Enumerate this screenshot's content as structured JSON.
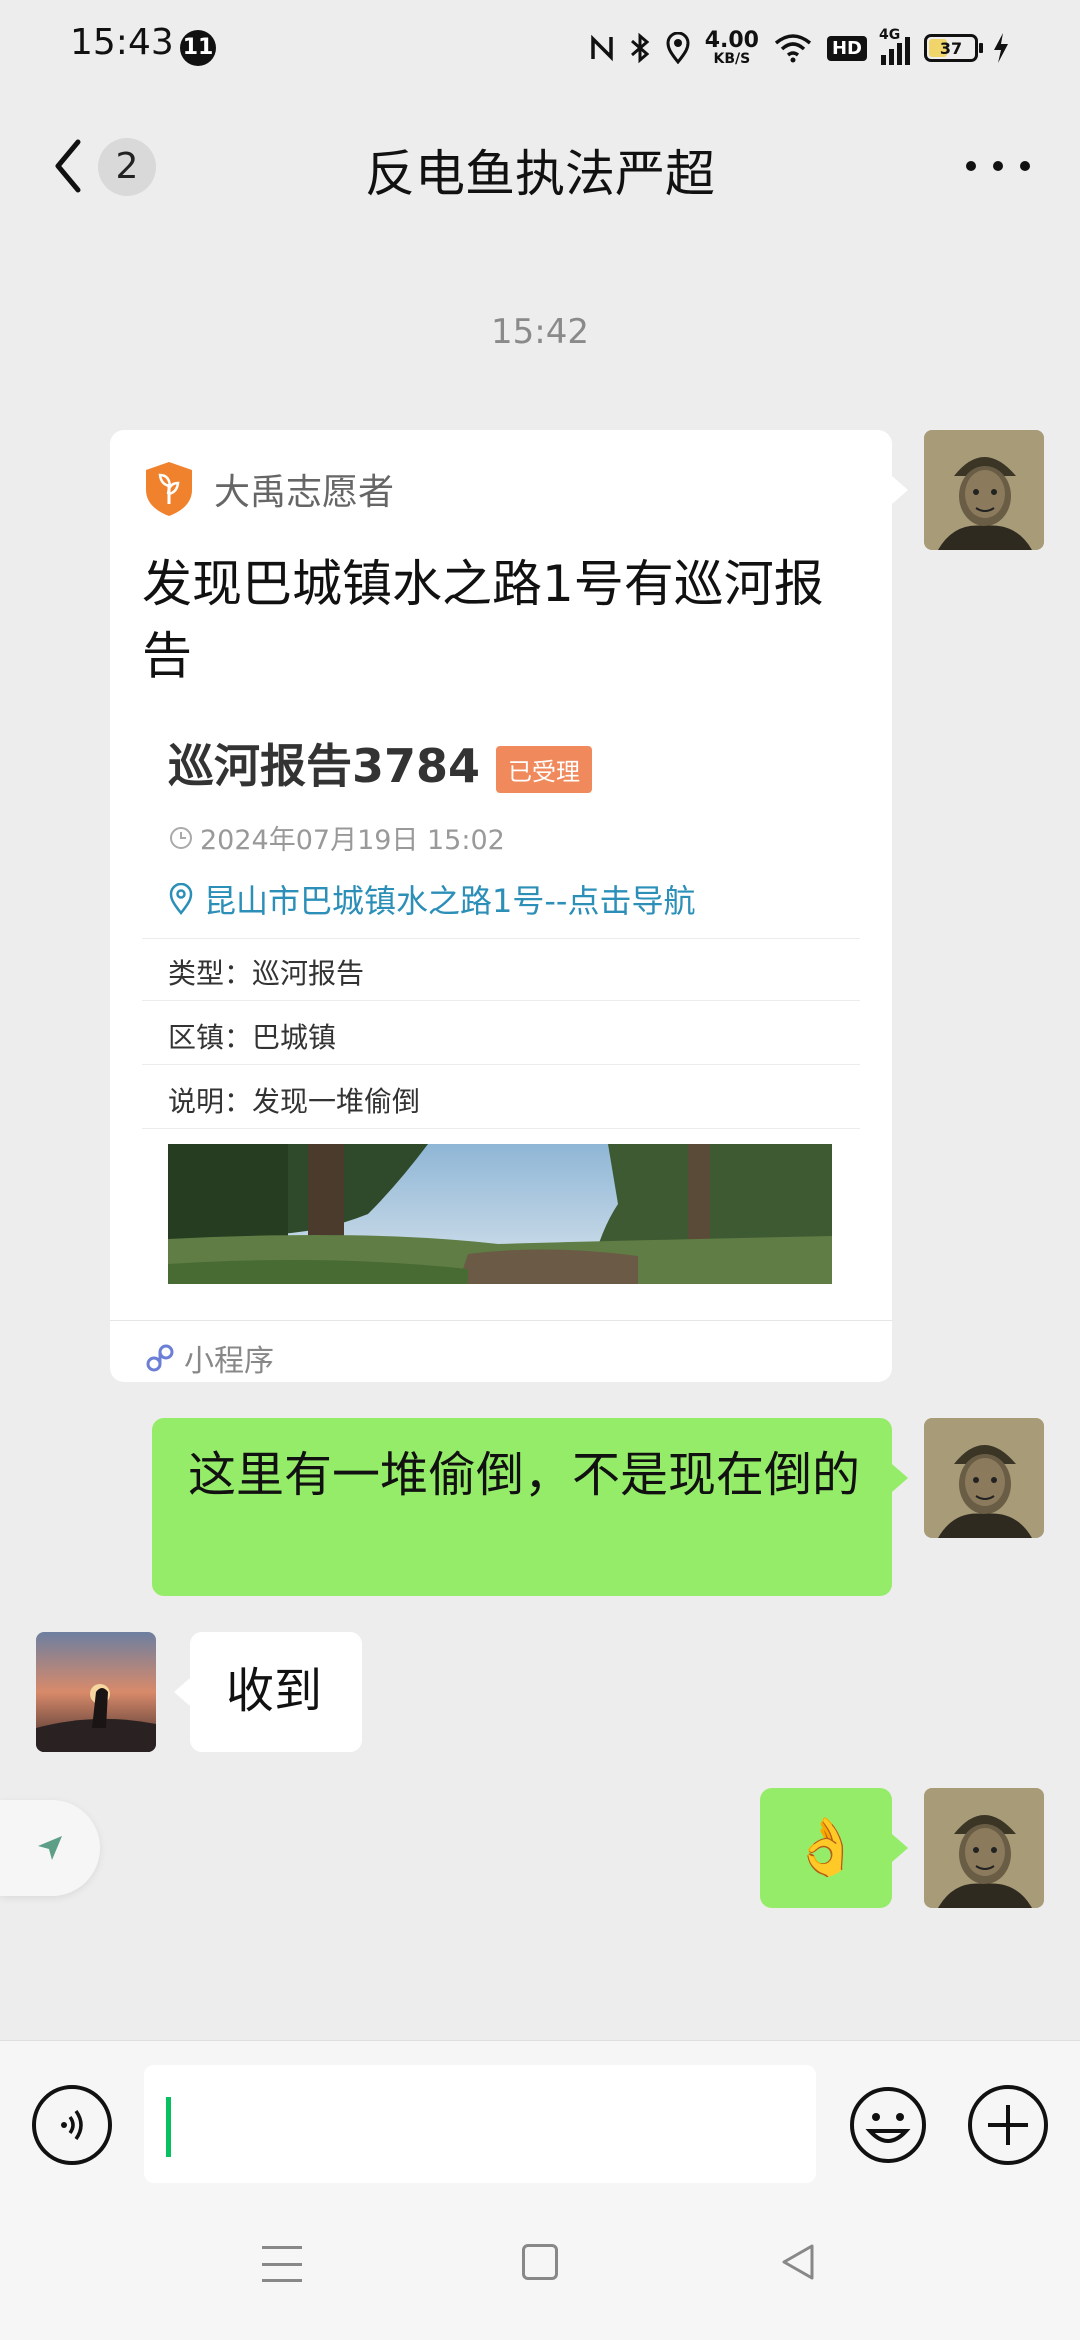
{
  "status_bar": {
    "time": "15:43",
    "notification_count": "11",
    "net_speed_value": "4.00",
    "net_speed_unit": "KB/S",
    "hd_label": "HD",
    "network_type": "4G",
    "battery_level": "37",
    "icons": [
      "nfc-icon",
      "bluetooth-icon",
      "location-icon",
      "wifi-icon",
      "signal-icon",
      "charging-icon"
    ]
  },
  "header": {
    "unread_count": "2",
    "title": "反电鱼执法严超"
  },
  "timestamp": "15:42",
  "card": {
    "source_name": "大禹志愿者",
    "title": "发现巴城镇水之路1号有巡河报告",
    "report_title": "巡河报告3784",
    "status_badge": "已受理",
    "report_time": "2024年07月19日 15:02",
    "location": "昆山市巴城镇水之路1号--点击导航",
    "rows": [
      {
        "label": "类型：",
        "value": "巡河报告"
      },
      {
        "label": "区镇：",
        "value": "巴城镇"
      },
      {
        "label": "说明：",
        "value": "发现一堆偷倒"
      }
    ],
    "footer": "小程序"
  },
  "messages": {
    "me_1": "这里有一堆偷倒，不是现在倒的",
    "other_1": "收到",
    "me_2_emoji": "👌"
  },
  "colors": {
    "bubble_green": "#95ec69",
    "badge_orange": "#f08a5d",
    "link_blue": "#2b8fb8",
    "caret_green": "#07c160"
  }
}
